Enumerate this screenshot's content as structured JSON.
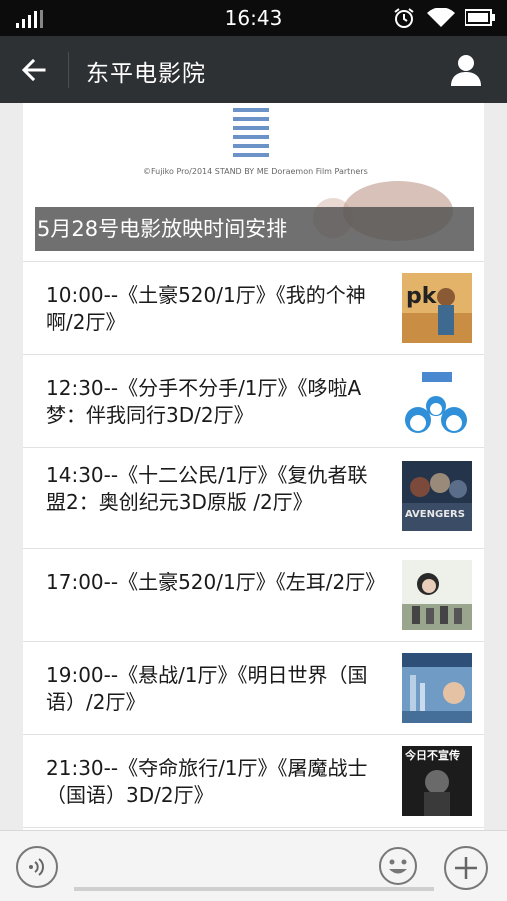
{
  "status_bar": {
    "time": "16:43"
  },
  "nav": {
    "title": "东平电影院"
  },
  "article": {
    "cover_caption": "5月28号电影放映时间安排",
    "cover_credit": "©Fujiko Pro/2014 STAND BY ME Doraemon Film Partners"
  },
  "schedule": [
    {
      "text": "10:00--《土豪520/1厅》《我的个神啊/2厅》",
      "thumb_icon": "pk-poster-icon"
    },
    {
      "text": "12:30--《分手不分手/1厅》《哆啦A梦：伴我同行3D/2厅》",
      "thumb_icon": "doraemon-poster-icon"
    },
    {
      "text": "14:30--《十二公民/1厅》《复仇者联盟2：奥创纪元3D原版 /2厅》",
      "thumb_icon": "avengers-poster-icon",
      "thumb_label": "AVENGERS"
    },
    {
      "text": "17:00--《土豪520/1厅》《左耳/2厅》",
      "thumb_icon": "left-ear-poster-icon"
    },
    {
      "text": "19:00--《悬战/1厅》《明日世界（国语）/2厅》",
      "thumb_icon": "tomorrowland-poster-icon"
    },
    {
      "text": "21:30--《夺命旅行/1厅》《屠魔战士（国语）3D/2厅》",
      "thumb_icon": "i-frankenstein-poster-icon",
      "thumb_label": "今日不宣传"
    }
  ],
  "input_bar": {
    "voice_icon": "voice-icon",
    "emoji_icon": "emoji-icon",
    "plus_icon": "plus-icon"
  },
  "colors": {
    "nav_bg": "#2d3134",
    "status_bg": "#0c0c0c",
    "page_bg": "#ececec"
  }
}
